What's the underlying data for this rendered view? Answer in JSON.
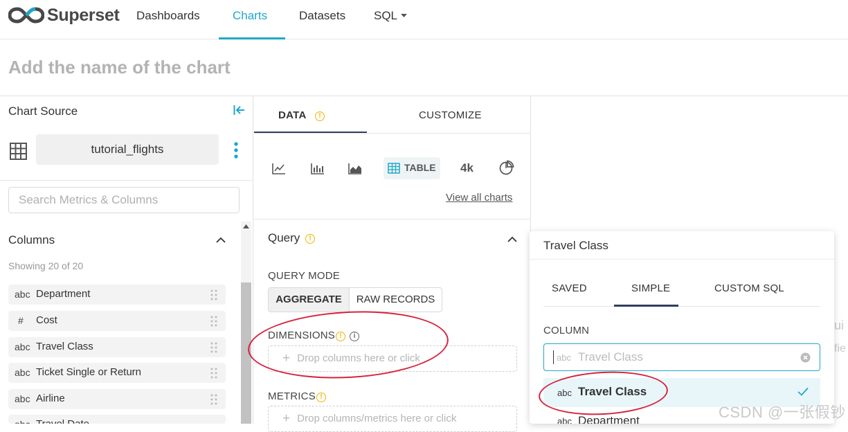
{
  "nav": {
    "brand": "Superset",
    "items": [
      {
        "label": "Dashboards"
      },
      {
        "label": "Charts"
      },
      {
        "label": "Datasets"
      },
      {
        "label": "SQL"
      }
    ]
  },
  "chart_title_placeholder": "Add the name of the chart",
  "datasource": {
    "heading": "Chart Source",
    "name": "tutorial_flights",
    "search_placeholder": "Search Metrics & Columns",
    "columns_heading": "Columns",
    "showing": "Showing 20 of 20",
    "columns": [
      {
        "type": "abc",
        "name": "Department"
      },
      {
        "type": "#",
        "name": "Cost"
      },
      {
        "type": "abc",
        "name": "Travel Class"
      },
      {
        "type": "abc",
        "name": "Ticket Single or Return"
      },
      {
        "type": "abc",
        "name": "Airline"
      },
      {
        "type": "abc",
        "name": "Travel Date"
      }
    ]
  },
  "control_panel": {
    "tabs": [
      {
        "label": "DATA"
      },
      {
        "label": "CUSTOMIZE"
      }
    ],
    "viz_types": {
      "table_label": "TABLE",
      "bignumber_label": "4k",
      "view_all": "View all charts"
    },
    "query": {
      "heading": "Query",
      "mode_label": "QUERY MODE",
      "modes": [
        {
          "label": "AGGREGATE"
        },
        {
          "label": "RAW RECORDS"
        }
      ],
      "dimensions_label": "DIMENSIONS",
      "dimensions_drop": "Drop columns here or click",
      "metrics_label": "METRICS",
      "metrics_drop": "Drop columns/metrics here or click"
    }
  },
  "popover": {
    "title": "Travel Class",
    "tabs": [
      {
        "label": "SAVED"
      },
      {
        "label": "SIMPLE"
      },
      {
        "label": "CUSTOM SQL"
      }
    ],
    "column_label": "COLUMN",
    "select_type": "abc",
    "select_value": "Travel Class",
    "options": [
      {
        "type": "abc",
        "name": "Travel Class"
      },
      {
        "type": "abc",
        "name": "Department"
      }
    ]
  },
  "right_cut_text": {
    "line1": "ui",
    "line2": "fie"
  },
  "watermark": "CSDN @一张假钞",
  "colors": {
    "accent": "#20a7c9",
    "annotation": "#d7223f",
    "warning": "#f0b400"
  }
}
